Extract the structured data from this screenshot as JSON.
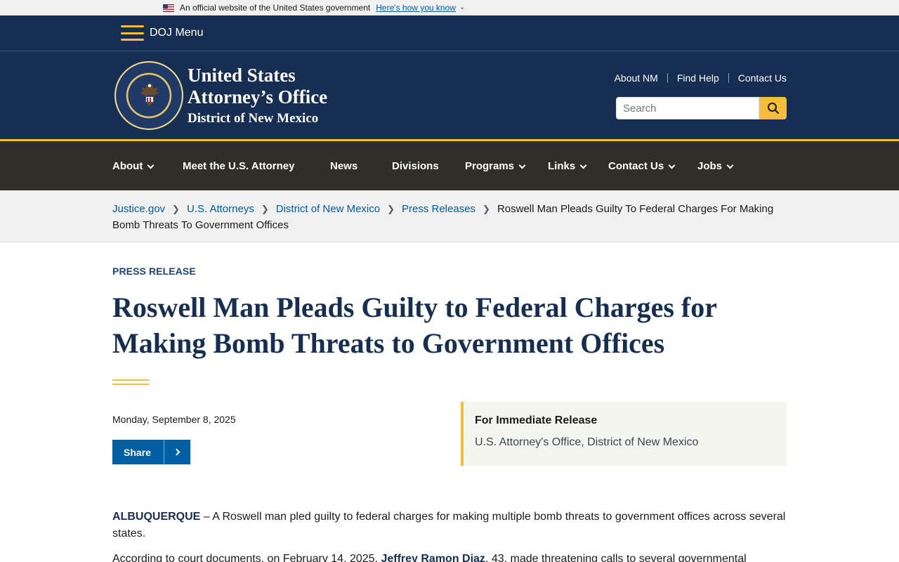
{
  "gov_banner": {
    "text": "An official website of the United States government",
    "link": "Here's how you know"
  },
  "doj_menu": {
    "label": "DOJ Menu"
  },
  "header": {
    "agency_line1": "United States",
    "agency_line2": "Attorney’s Office",
    "agency_line3": "District of New Mexico",
    "util_links": [
      "About NM",
      "Find Help",
      "Contact Us"
    ],
    "search_placeholder": "Search"
  },
  "nav": {
    "items": [
      {
        "label": "About",
        "dropdown": true
      },
      {
        "label": "Meet the U.S. Attorney",
        "dropdown": false
      },
      {
        "label": "News",
        "dropdown": false
      },
      {
        "label": "Divisions",
        "dropdown": false
      },
      {
        "label": "Programs",
        "dropdown": true
      },
      {
        "label": "Links",
        "dropdown": true
      },
      {
        "label": "Contact Us",
        "dropdown": true
      },
      {
        "label": "Jobs",
        "dropdown": true
      }
    ]
  },
  "breadcrumb": {
    "links": [
      "Justice.gov",
      "U.S. Attorneys",
      "District of New Mexico",
      "Press Releases"
    ],
    "current": "Roswell Man Pleads Guilty To Federal Charges For Making Bomb Threats To Government Offices"
  },
  "article": {
    "eyebrow": "PRESS RELEASE",
    "title": "Roswell Man Pleads Guilty to Federal Charges for Making Bomb Threats to Government Offices",
    "date": "Monday, September 8, 2025",
    "share_label": "Share",
    "release_title": "For Immediate Release",
    "release_office": "U.S. Attorney's Office, District of New Mexico",
    "para1_place": "ALBUQUERQUE",
    "para1_text": " – A Roswell man pled guilty to federal charges for making multiple bomb threats to government offices across several states.",
    "para2_lead": "According to court documents, on February 14, 2025, ",
    "para2_name": "Jeffrey Ramon Diaz",
    "para2_rest": ", 43, made threatening calls to several governmental"
  },
  "colors": {
    "navy": "#162e51",
    "gold": "#f6bd3a",
    "nav_bg": "#2f2e28",
    "link_blue": "#005ea2"
  }
}
